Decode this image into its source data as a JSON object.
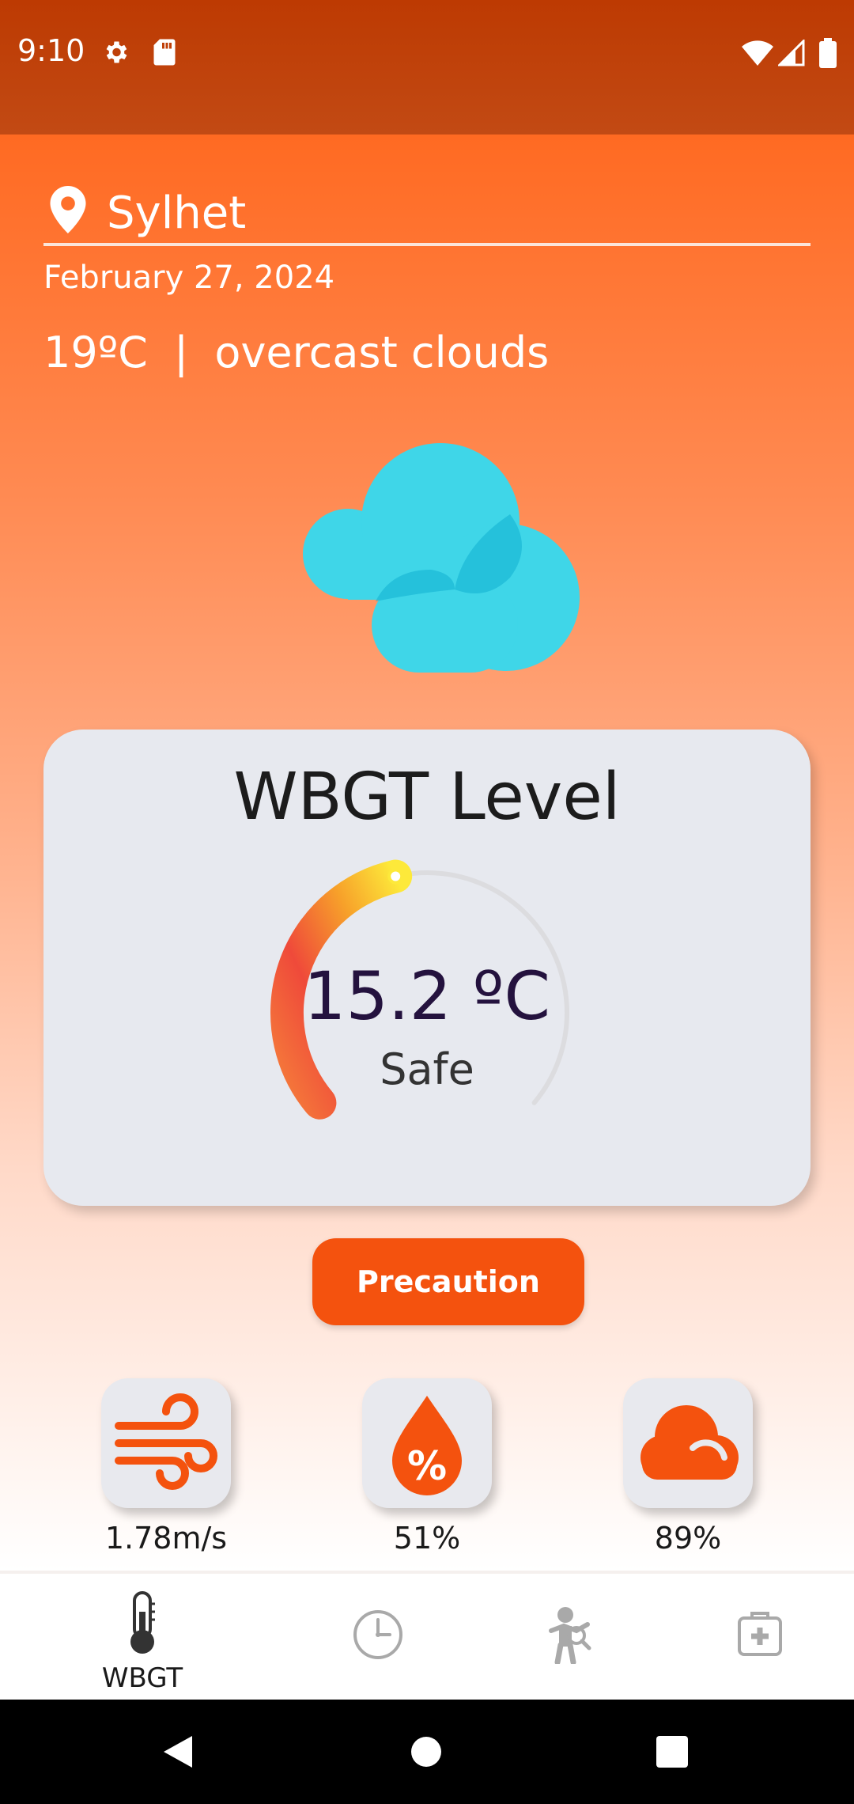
{
  "status_bar": {
    "time": "9:10",
    "icons": [
      "gear-icon",
      "sd-card-icon",
      "wifi-icon",
      "signal-icon",
      "battery-icon"
    ]
  },
  "location": {
    "icon": "location-pin-icon",
    "city": "Sylhet"
  },
  "date": "February 27, 2024",
  "weather": {
    "temperature": "19ºC",
    "separator": "|",
    "description": "overcast clouds",
    "icon": "cloud-icon"
  },
  "wbgt": {
    "title": "WBGT Level",
    "value": "15.2 ºC",
    "status": "Safe",
    "gauge_fraction": 0.45
  },
  "precaution_button": "Precaution",
  "metrics": [
    {
      "icon": "wind-icon",
      "value": "1.78m/s"
    },
    {
      "icon": "humidity-icon",
      "value": "51%"
    },
    {
      "icon": "cloudiness-icon",
      "value": "89%"
    }
  ],
  "nav": [
    {
      "icon": "thermometer-icon",
      "label": "WBGT",
      "active": true
    },
    {
      "icon": "clock-icon",
      "label": ""
    },
    {
      "icon": "person-activity-icon",
      "label": ""
    },
    {
      "icon": "first-aid-icon",
      "label": ""
    }
  ],
  "colors": {
    "accent": "#f4520e",
    "status_bar": "#bd3a02",
    "card": "#e7e9ef",
    "cloud": "#3fd6e8",
    "gauge_value_text": "#24123e"
  }
}
